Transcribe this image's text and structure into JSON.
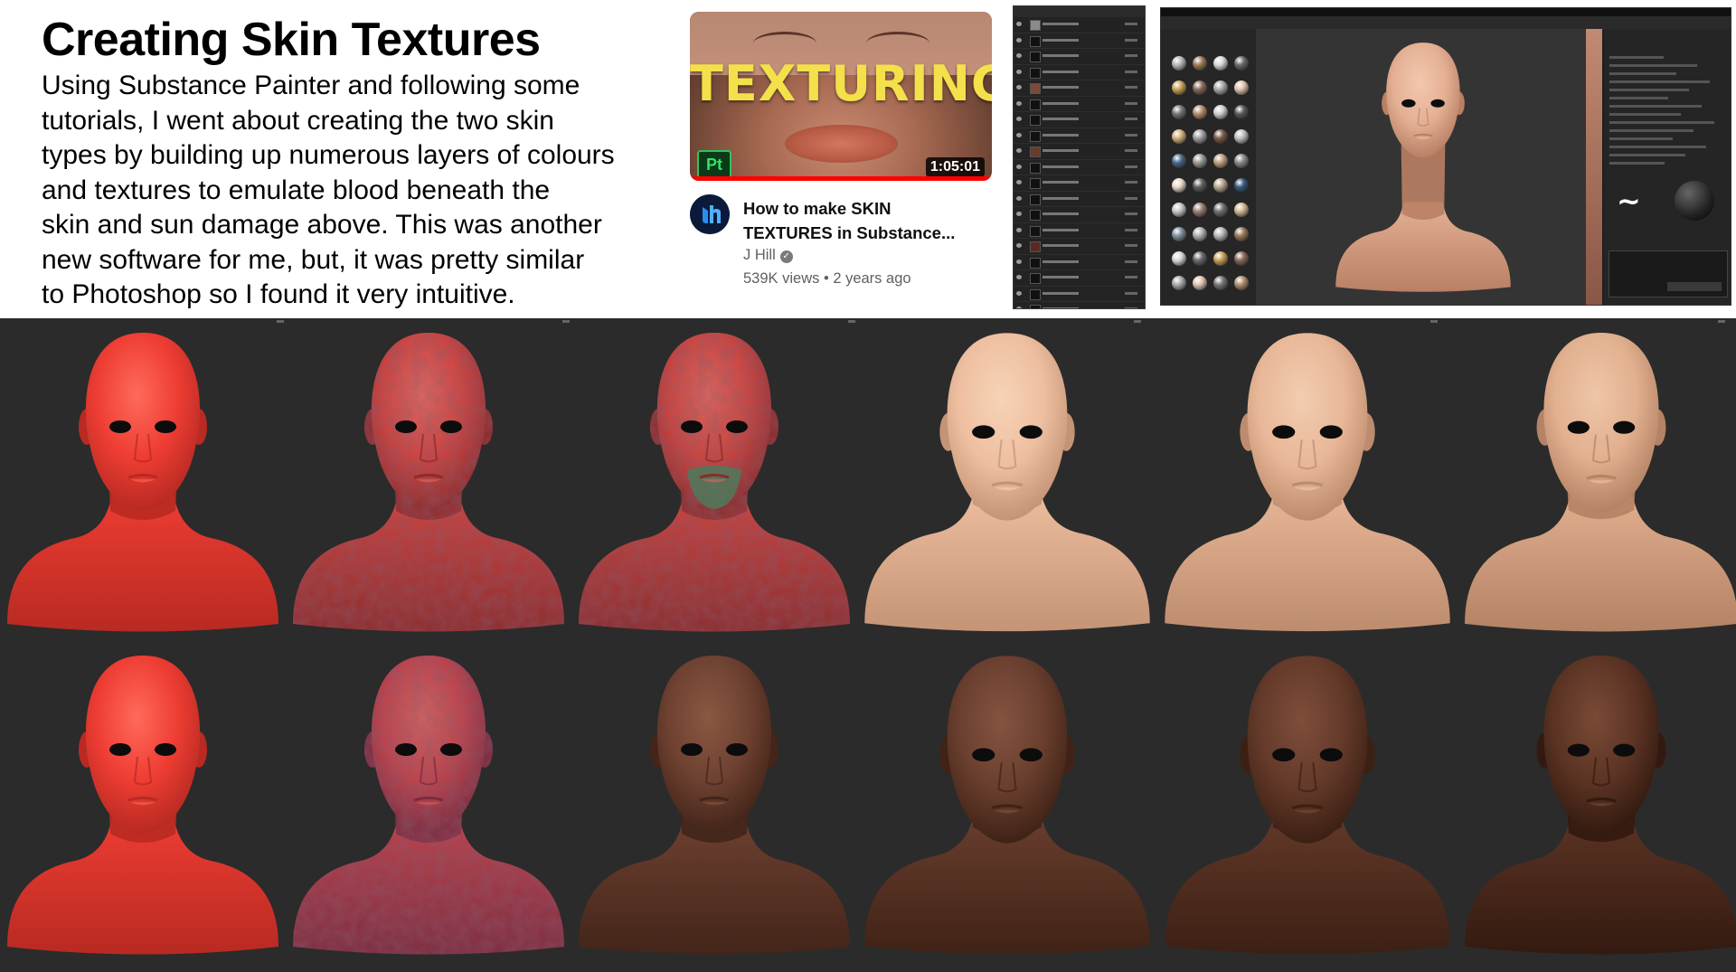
{
  "page": {
    "title": "Creating Skin Textures",
    "body_lines": [
      "Using Substance Painter and following some",
      "tutorials, I went about creating the two skin",
      "types by building  up numerous  layers of colours",
      "and textures to emulate blood beneath the",
      "skin and sun damage above. This was another",
      "new software for me, but, it was pretty similar",
      "to Photoshop so I found it very intuitive."
    ]
  },
  "video": {
    "thumbnail_word": "TEXTURING",
    "badge": "Pt",
    "duration": "1:05:01",
    "progress_fraction": 1.0,
    "title_line1": "How to make SKIN",
    "title_line2": "TEXTURES in Substance...",
    "channel": "J Hill",
    "meta": "539K views • 2 years ago",
    "icons": [
      "channel-avatar-icon",
      "verified-check-icon"
    ]
  },
  "renders": {
    "rows": [
      {
        "name": "row-light-skin",
        "stages": [
          {
            "label": "base-red",
            "skin": "#ee3d33",
            "shade": "#b82a22",
            "hi": "#ff6a5a"
          },
          {
            "label": "red-mottled",
            "skin": "#d6413a",
            "shade": "#8e2a2a",
            "hi": "#e9685e",
            "mottled": true
          },
          {
            "label": "red-mottled-green-beard",
            "skin": "#d3423a",
            "shade": "#8c2b2b",
            "hi": "#e5665a",
            "mottled": true,
            "beard": "#4d7a5c"
          },
          {
            "label": "pale-tan",
            "skin": "#eebfa0",
            "shade": "#c59476",
            "hi": "#f7d3b8"
          },
          {
            "label": "pale-tan-detail",
            "skin": "#e8b898",
            "shade": "#bd8c6e",
            "hi": "#f3ccb0"
          },
          {
            "label": "pale-final",
            "skin": "#e1b08f",
            "shade": "#b48264",
            "hi": "#efc6a8"
          }
        ]
      },
      {
        "name": "row-dark-skin",
        "stages": [
          {
            "label": "base-red",
            "skin": "#ee3d33",
            "shade": "#b82a22",
            "hi": "#ff6a5a"
          },
          {
            "label": "red-purple-mottled",
            "skin": "#c44048",
            "shade": "#7c2a3e",
            "hi": "#d8635e",
            "mottled": true
          },
          {
            "label": "dark-brown",
            "skin": "#6e4131",
            "shade": "#432519",
            "hi": "#8a5842"
          },
          {
            "label": "dark-brown-2",
            "skin": "#6a3f2f",
            "shade": "#402316",
            "hi": "#855340"
          },
          {
            "label": "dark-brown-3",
            "skin": "#643a2a",
            "shade": "#3c2014",
            "hi": "#7f4d3a"
          },
          {
            "label": "dark-final",
            "skin": "#5c3424",
            "shade": "#331a10",
            "hi": "#7a4a36"
          }
        ]
      }
    ]
  },
  "colors": {
    "render_bg": "#2b2b2b",
    "youtube_red": "#ff0000",
    "thumb_text": "#f4e04a"
  }
}
